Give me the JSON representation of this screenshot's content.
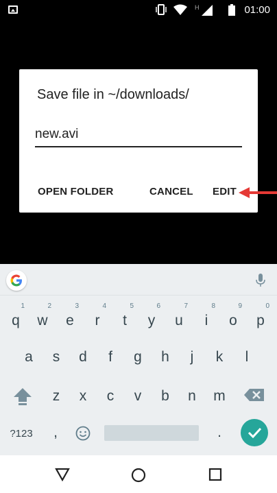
{
  "status_bar": {
    "time": "01:00",
    "icons": [
      "image-icon",
      "vibrate-icon",
      "wifi-icon",
      "signal-h-icon",
      "battery-icon"
    ]
  },
  "dialog": {
    "title": "Save file in ~/downloads/",
    "filename_value": "new.avi",
    "buttons": {
      "open_folder": "OPEN FOLDER",
      "cancel": "CANCEL",
      "edit": "EDIT"
    }
  },
  "annotation": {
    "arrow_color": "#e53935"
  },
  "keyboard": {
    "row1": [
      {
        "key": "q",
        "hint": "1"
      },
      {
        "key": "w",
        "hint": "2"
      },
      {
        "key": "e",
        "hint": "3"
      },
      {
        "key": "r",
        "hint": "4"
      },
      {
        "key": "t",
        "hint": "5"
      },
      {
        "key": "y",
        "hint": "6"
      },
      {
        "key": "u",
        "hint": "7"
      },
      {
        "key": "i",
        "hint": "8"
      },
      {
        "key": "o",
        "hint": "9"
      },
      {
        "key": "p",
        "hint": "0"
      }
    ],
    "row2": [
      "a",
      "s",
      "d",
      "f",
      "g",
      "h",
      "j",
      "k",
      "l"
    ],
    "row3": [
      "z",
      "x",
      "c",
      "v",
      "b",
      "n",
      "m"
    ],
    "row4": {
      "symbols": "?123",
      "comma": ",",
      "period": "."
    },
    "accent_color": "#26a69a"
  }
}
